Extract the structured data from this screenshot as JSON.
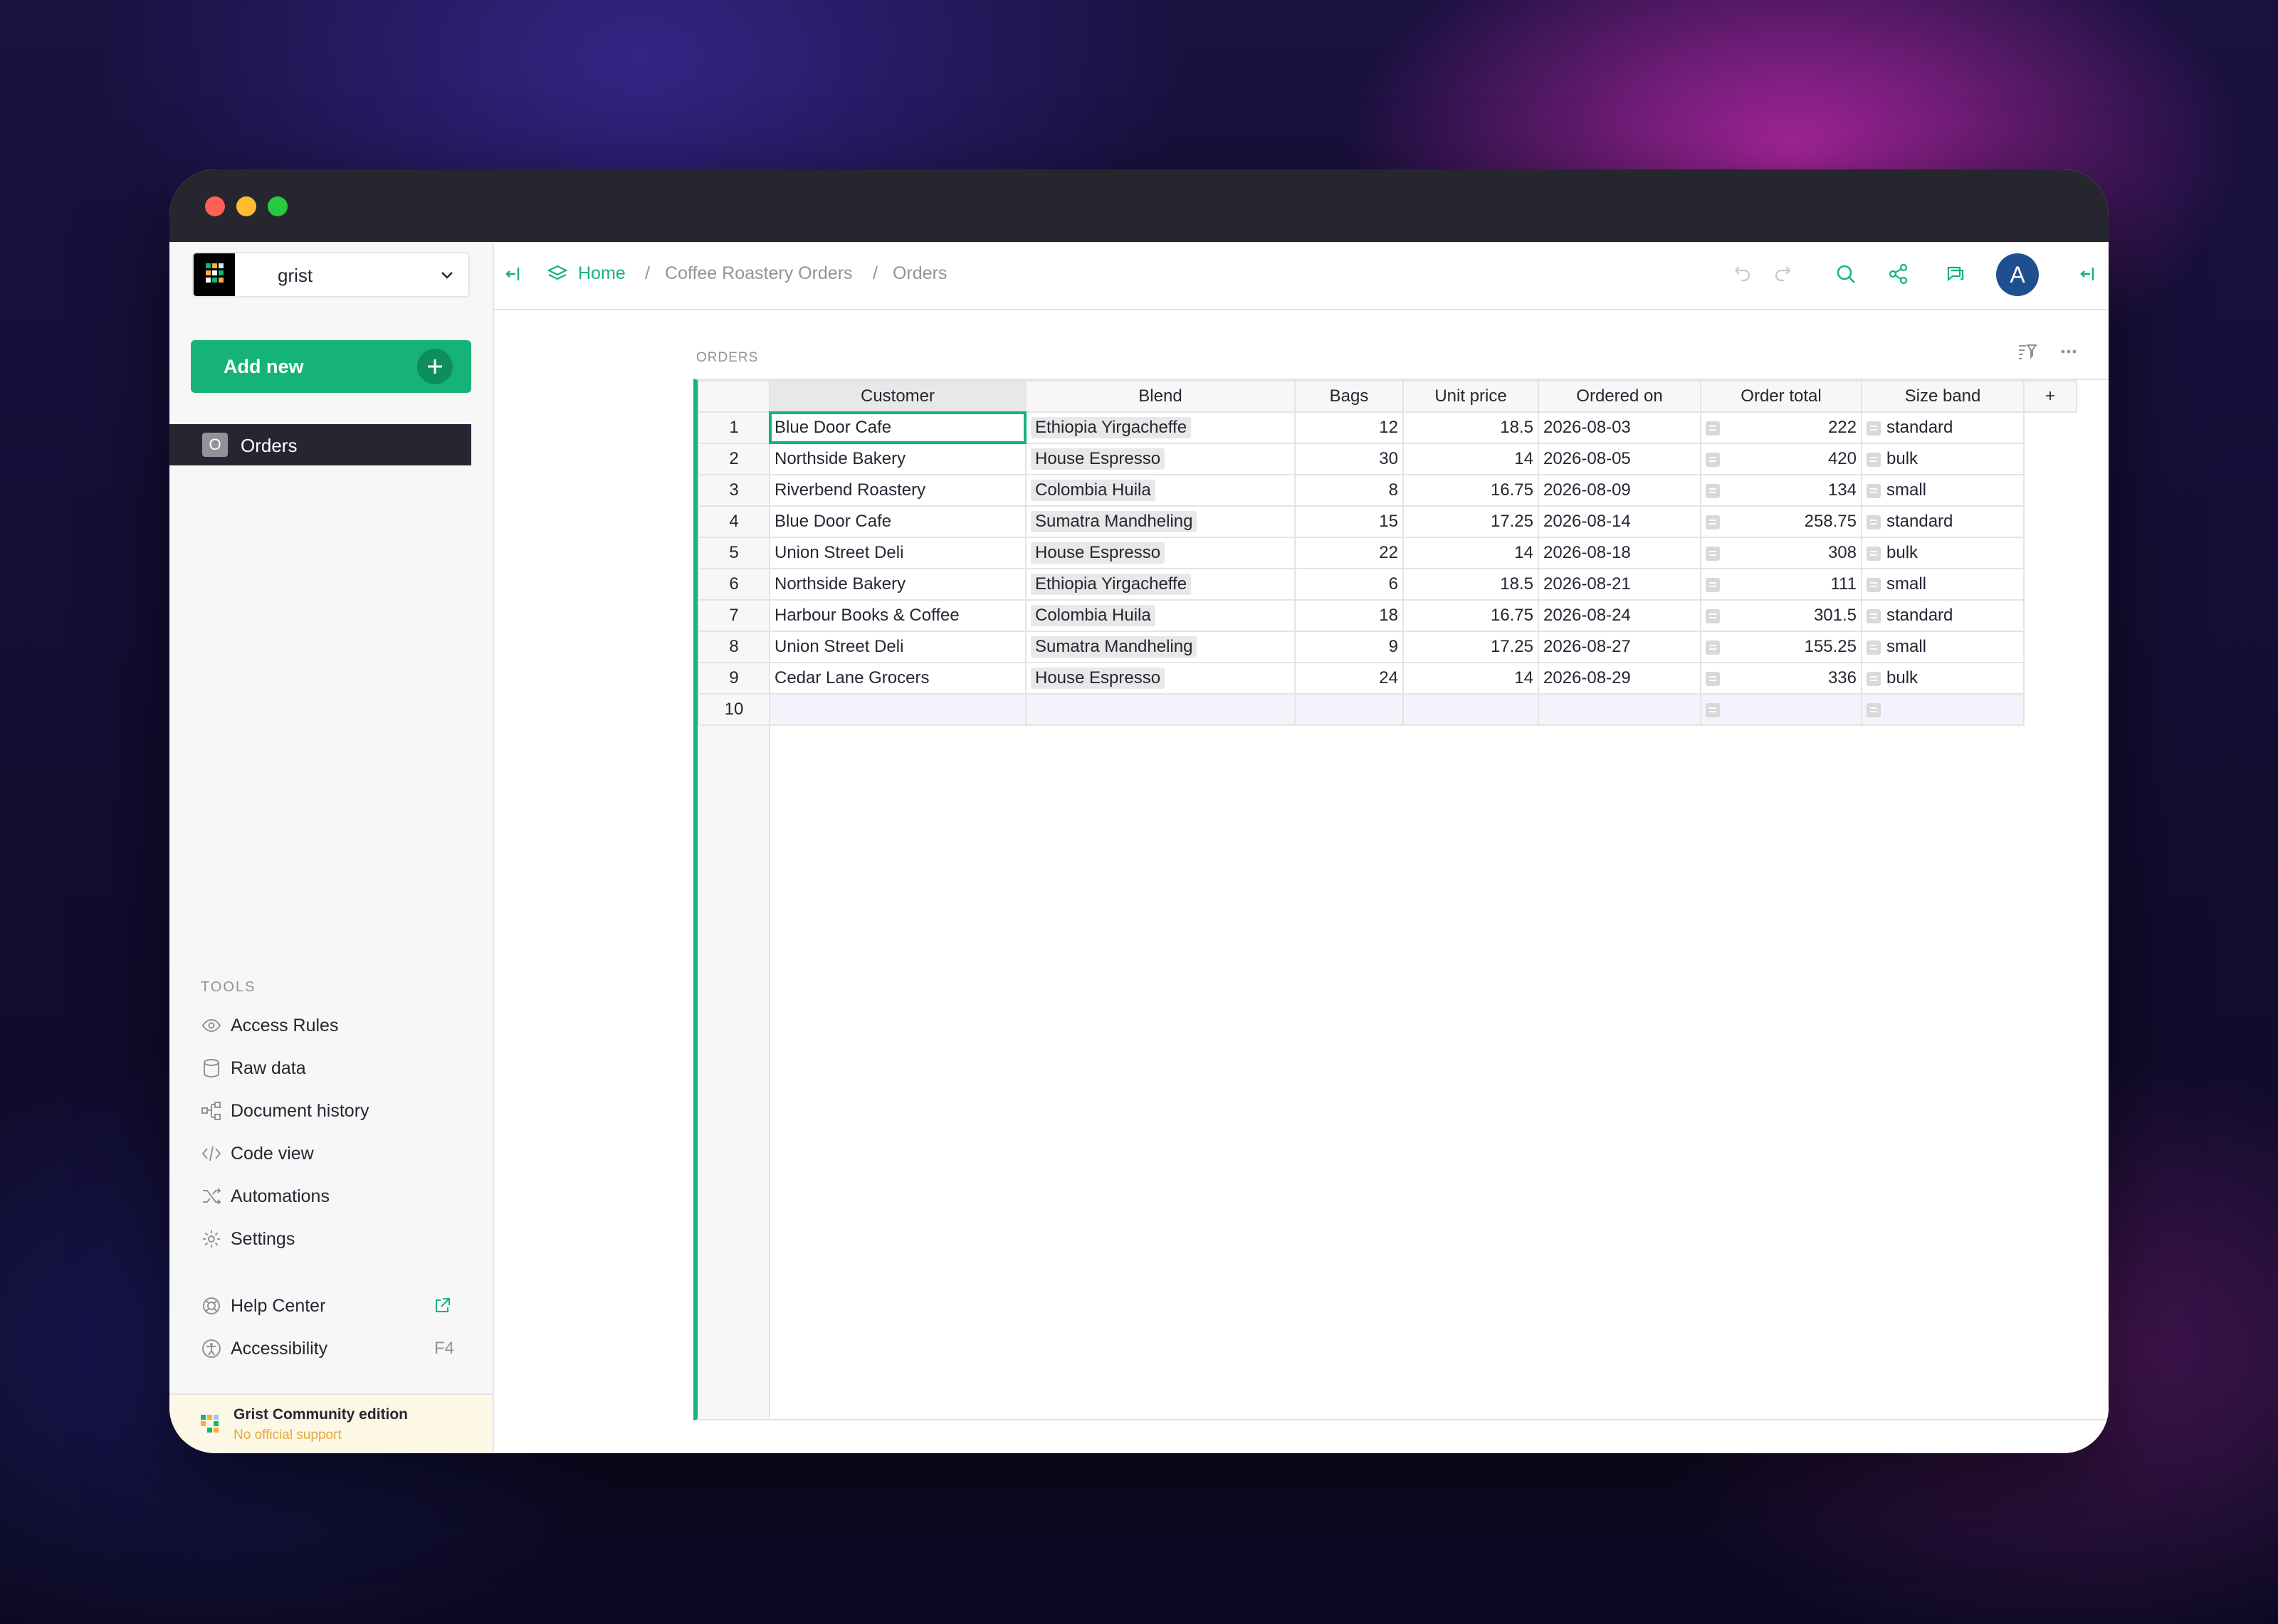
{
  "workspace": {
    "name": "grist"
  },
  "sidebar": {
    "add_new_label": "Add new",
    "pages": [
      {
        "icon_letter": "O",
        "label": "Orders"
      }
    ],
    "tools_title": "TOOLS",
    "tools": [
      {
        "icon": "eye-icon",
        "label": "Access Rules"
      },
      {
        "icon": "database-icon",
        "label": "Raw data"
      },
      {
        "icon": "history-icon",
        "label": "Document history"
      },
      {
        "icon": "code-icon",
        "label": "Code view"
      },
      {
        "icon": "shuffle-icon",
        "label": "Automations"
      },
      {
        "icon": "gear-icon",
        "label": "Settings"
      }
    ],
    "help_center_label": "Help Center",
    "accessibility_label": "Accessibility",
    "accessibility_shortcut": "F4",
    "edition_title": "Grist Community edition",
    "edition_subtitle": "No official support"
  },
  "breadcrumb": {
    "home": "Home",
    "doc": "Coffee Roastery Orders",
    "page": "Orders",
    "sep": "/"
  },
  "user": {
    "avatar_letter": "A"
  },
  "section": {
    "title": "ORDERS"
  },
  "table": {
    "columns": [
      "Customer",
      "Blend",
      "Bags",
      "Unit price",
      "Ordered on",
      "Order total",
      "Size band"
    ],
    "add_column": "+",
    "rows": [
      {
        "n": "1",
        "customer": "Blue Door Cafe",
        "blend": "Ethiopia Yirgacheffe",
        "bags": "12",
        "price": "18.5",
        "date": "2026-08-03",
        "total": "222",
        "band": "standard"
      },
      {
        "n": "2",
        "customer": "Northside Bakery",
        "blend": "House Espresso",
        "bags": "30",
        "price": "14",
        "date": "2026-08-05",
        "total": "420",
        "band": "bulk"
      },
      {
        "n": "3",
        "customer": "Riverbend Roastery",
        "blend": "Colombia Huila",
        "bags": "8",
        "price": "16.75",
        "date": "2026-08-09",
        "total": "134",
        "band": "small"
      },
      {
        "n": "4",
        "customer": "Blue Door Cafe",
        "blend": "Sumatra Mandheling",
        "bags": "15",
        "price": "17.25",
        "date": "2026-08-14",
        "total": "258.75",
        "band": "standard"
      },
      {
        "n": "5",
        "customer": "Union Street Deli",
        "blend": "House Espresso",
        "bags": "22",
        "price": "14",
        "date": "2026-08-18",
        "total": "308",
        "band": "bulk"
      },
      {
        "n": "6",
        "customer": "Northside Bakery",
        "blend": "Ethiopia Yirgacheffe",
        "bags": "6",
        "price": "18.5",
        "date": "2026-08-21",
        "total": "111",
        "band": "small"
      },
      {
        "n": "7",
        "customer": "Harbour Books & Coffee",
        "blend": "Colombia Huila",
        "bags": "18",
        "price": "16.75",
        "date": "2026-08-24",
        "total": "301.5",
        "band": "standard"
      },
      {
        "n": "8",
        "customer": "Union Street Deli",
        "blend": "Sumatra Mandheling",
        "bags": "9",
        "price": "17.25",
        "date": "2026-08-27",
        "total": "155.25",
        "band": "small"
      },
      {
        "n": "9",
        "customer": "Cedar Lane Grocers",
        "blend": "House Espresso",
        "bags": "24",
        "price": "14",
        "date": "2026-08-29",
        "total": "336",
        "band": "bulk"
      }
    ],
    "new_row_number": "10"
  },
  "colors": {
    "accent": "#16b378",
    "dark": "#262633",
    "avatar": "#1f4f8f"
  }
}
